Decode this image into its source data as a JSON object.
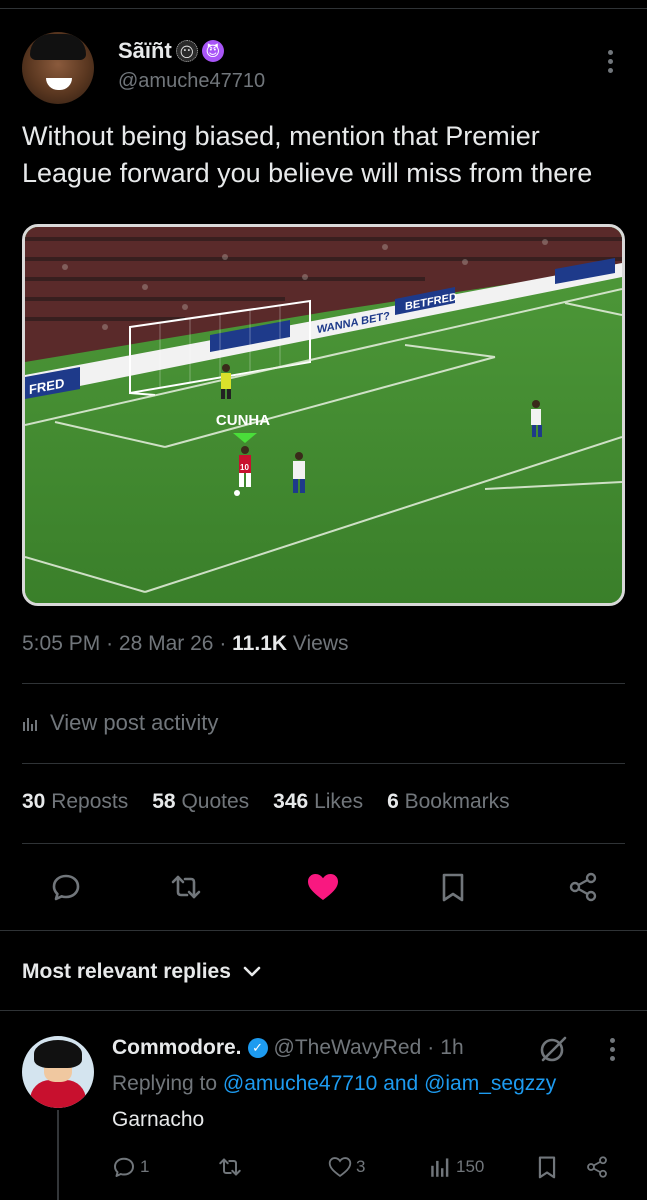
{
  "post": {
    "display_name": "Sãïñt",
    "emojis": [
      "😶",
      "😈"
    ],
    "handle": "@amuche47710",
    "text": "Without being biased, mention that Premier League forward you believe will miss from there",
    "media": {
      "player_label": "CUNHA",
      "player_number": "10",
      "ad_text_1": "WANNA BET?",
      "ad_text_2": "BETFRED",
      "ad_text_3": "FRED"
    },
    "time": "5:05 PM",
    "separator": "·",
    "date": "28 Mar 26",
    "views_count": "11.1K",
    "views_label": "Views",
    "activity_label": "View post activity",
    "stats": {
      "reposts_n": "30",
      "reposts_l": "Reposts",
      "quotes_n": "58",
      "quotes_l": "Quotes",
      "likes_n": "346",
      "likes_l": "Likes",
      "bookmarks_n": "6",
      "bookmarks_l": "Bookmarks"
    }
  },
  "replies_header": {
    "label": "Most relevant replies"
  },
  "reply": {
    "name": "Commodore.",
    "verified": "✓",
    "handle": "@TheWavyRed",
    "sep": "·",
    "time": "1h",
    "replying_prefix": "Replying to",
    "replying_user1": "@amuche47710",
    "replying_and": "and",
    "replying_user2": "@iam_segzzy",
    "text": "Garnacho",
    "replies_count": "1",
    "likes_count": "3",
    "views_count": "150"
  },
  "colors": {
    "background": "#000000",
    "text": "#e7e9ea",
    "muted": "#71767b",
    "link": "#1d9bf0",
    "like": "#f91880",
    "divider": "#2f3336"
  }
}
